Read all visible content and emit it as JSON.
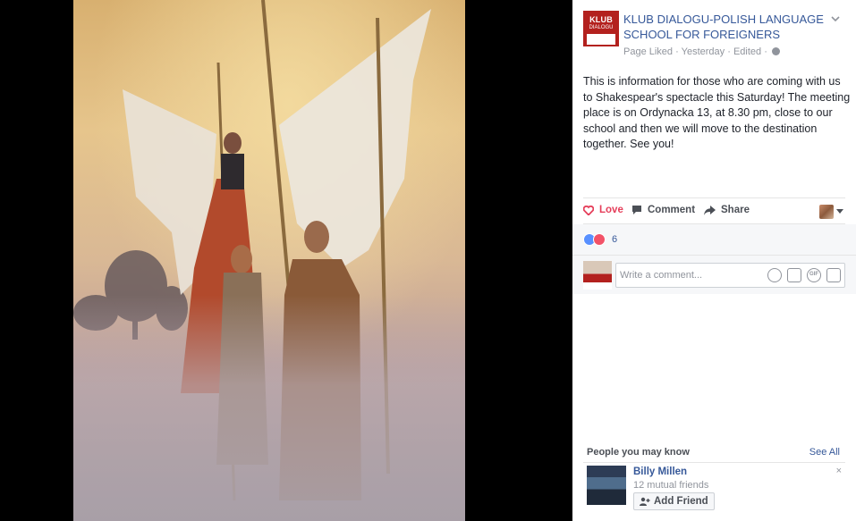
{
  "post": {
    "page_name": "KLUB DIALOGU-POLISH LANGUAGE SCHOOL FOR FOREIGNERS",
    "logo_line1": "KLUB",
    "logo_line2": "DIALOGU",
    "meta_page_liked": "Page Liked",
    "meta_sep1": " · ",
    "meta_time": "Yesterday",
    "meta_sep2": " · ",
    "meta_edited": "Edited",
    "meta_sep3": " · ",
    "text": "This is information for those who are coming with us to Shakespear's spectacle this Saturday! The meeting place is on Ordynacka 13, at 8.30 pm, close to our school and then we will move to the destination together. See you!"
  },
  "actions": {
    "love": "Love",
    "comment": "Comment",
    "share": "Share"
  },
  "reactions": {
    "count": "6"
  },
  "comment_box": {
    "placeholder": "Write a comment...",
    "gif_label": "GIF"
  },
  "people_you_may_know": {
    "title": "People you may know",
    "see_all": "See All",
    "person": {
      "name": "Billy Millen",
      "mutual": "12 mutual friends",
      "add_label": "Add Friend",
      "close": "×"
    }
  },
  "colors": {
    "link": "#365899",
    "love": "#e53e5a",
    "logo": "#b3211e"
  }
}
